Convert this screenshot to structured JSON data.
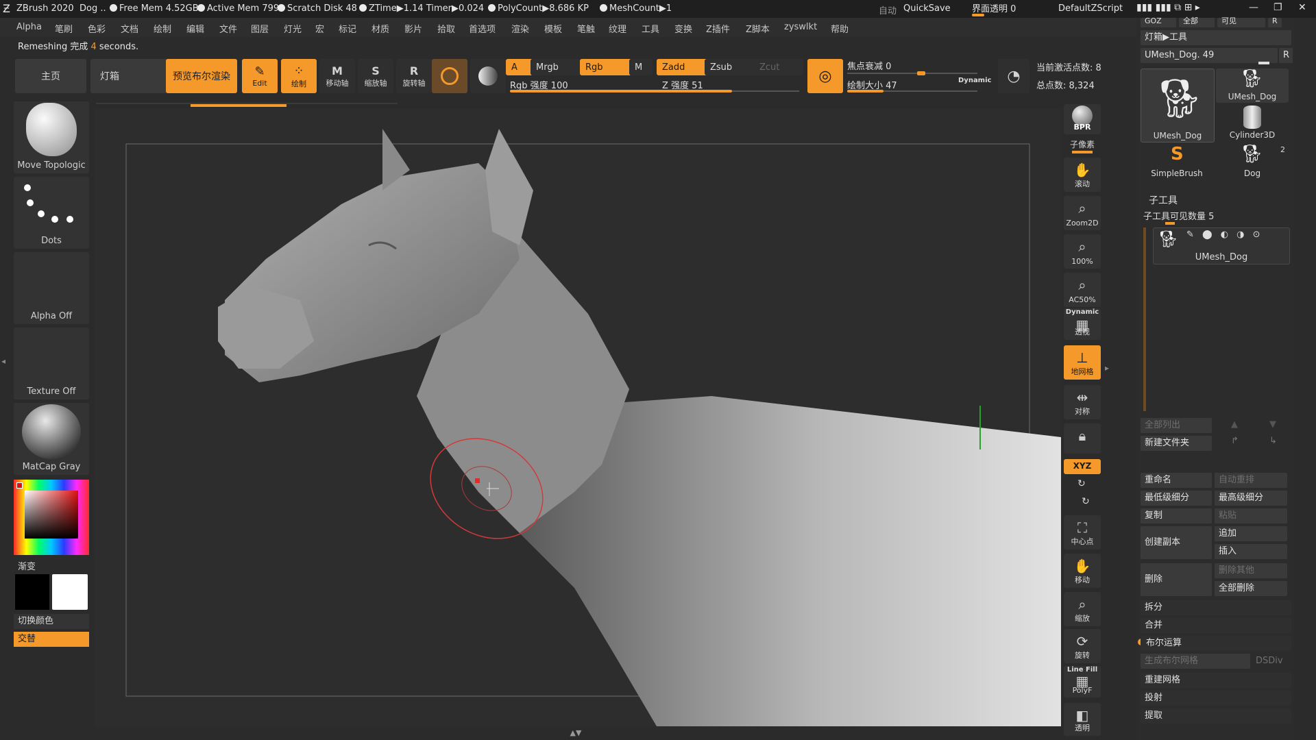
{
  "titlebar": {
    "app": "ZBrush 2020",
    "doc": "Dog ..",
    "free_mem": "Free Mem 4.52GB",
    "active_mem": "Active Mem 799",
    "scratch_disk": "Scratch Disk 48",
    "ztime": "ZTime▶1.14 Timer▶0.024",
    "polycount": "PolyCount▶8.686 KP",
    "meshcount": "MeshCount▶1",
    "auto": "自动",
    "quicksave": "QuickSave",
    "transparency": "界面透明 0",
    "script": "DefaultZScript"
  },
  "menu": [
    "Alpha",
    "笔刷",
    "色彩",
    "文档",
    "绘制",
    "编辑",
    "文件",
    "图层",
    "灯光",
    "宏",
    "标记",
    "材质",
    "影片",
    "拾取",
    "首选项",
    "渲染",
    "模板",
    "笔触",
    "纹理",
    "工具",
    "变换",
    "Z插件",
    "Z脚本",
    "zyswlkt",
    "帮助"
  ],
  "status": {
    "prefix": "Remeshing 完成 ",
    "count": "4",
    "suffix": " seconds."
  },
  "toolbar": {
    "home": "主页",
    "lightbox": "灯箱",
    "bpr_preview": "预览布尔渲染",
    "edit": "Edit",
    "draw": "绘制",
    "move": "移动轴",
    "scale": "缩放轴",
    "rotate": "旋转轴",
    "a": "A",
    "mrgb": "Mrgb",
    "rgb": "Rgb",
    "m": "M",
    "zadd": "Zadd",
    "zsub": "Zsub",
    "zcut": "Zcut",
    "rgb_intensity": "Rgb 强度 100",
    "z_intensity": "Z 强度 51",
    "focal_shift": "焦点衰减 0",
    "draw_size": "绘制大小 47",
    "dynamic": "Dynamic",
    "active_points": "当前激活点数: 8",
    "total_points": "总点数: 8,324",
    "rgb_intensity_frac": 1.0,
    "z_intensity_frac": 0.51,
    "draw_size_frac": 0.28
  },
  "left_shelf": {
    "brush": "Move Topologic",
    "stroke": "Dots",
    "alpha": "Alpha Off",
    "texture": "Texture Off",
    "material": "MatCap Gray",
    "gradient": "渐变",
    "switch_color": "切换颜色",
    "alternate": "交替"
  },
  "right_rail": {
    "bpr": "BPR",
    "subpixel": "子像素",
    "scroll": "滚动",
    "zoom2d": "Zoom2D",
    "pct100": "100%",
    "ac50": "AC50%",
    "persp_top": "Dynamic",
    "persp": "透视",
    "floor": "地网格",
    "symmetry": "对称",
    "lock": "",
    "xyz": "XYZ",
    "center": "中心点",
    "move": "移动",
    "zoom": "缩放",
    "rotate": "旋转",
    "linefill_top": "Line Fill",
    "polyf": "PolyF",
    "transp": "透明"
  },
  "right_panel": {
    "top_partial": [
      "GOZ",
      "全部",
      "可见",
      "R"
    ],
    "lightbox_tool": "灯箱▶工具",
    "current_tool": "UMesh_Dog. 49",
    "r": "R",
    "thumbs": [
      "UMesh_Dog",
      "UMesh_Dog",
      "Cylinder3D",
      "SimpleBrush",
      "Dog"
    ],
    "dog_count": "2",
    "subtool_header": "子工具",
    "subtool_visible": "子工具可见数量 5",
    "subtool_item": "UMesh_Dog",
    "list_all": "全部列出",
    "new_folder": "新建文件夹",
    "rename": "重命名",
    "auto_reorder": "自动重排",
    "lowest_sub": "最低级细分",
    "highest_sub": "最高级细分",
    "copy": "复制",
    "paste": "粘贴",
    "duplicate": "创建副本",
    "append": "追加",
    "insert": "插入",
    "delete": "删除",
    "delete_other": "删除其他",
    "delete_all": "全部删除",
    "split": "拆分",
    "merge": "合并",
    "boolean": "布尔运算",
    "make_bool_mesh": "生成布尔网格",
    "dsdiv": "DSDiv",
    "remesh": "重建网格",
    "project": "投射",
    "extract": "提取"
  },
  "colors": {
    "accent": "#f59a2a",
    "bg": "#2b2b2b",
    "brush_ring": "#d23a3a"
  }
}
